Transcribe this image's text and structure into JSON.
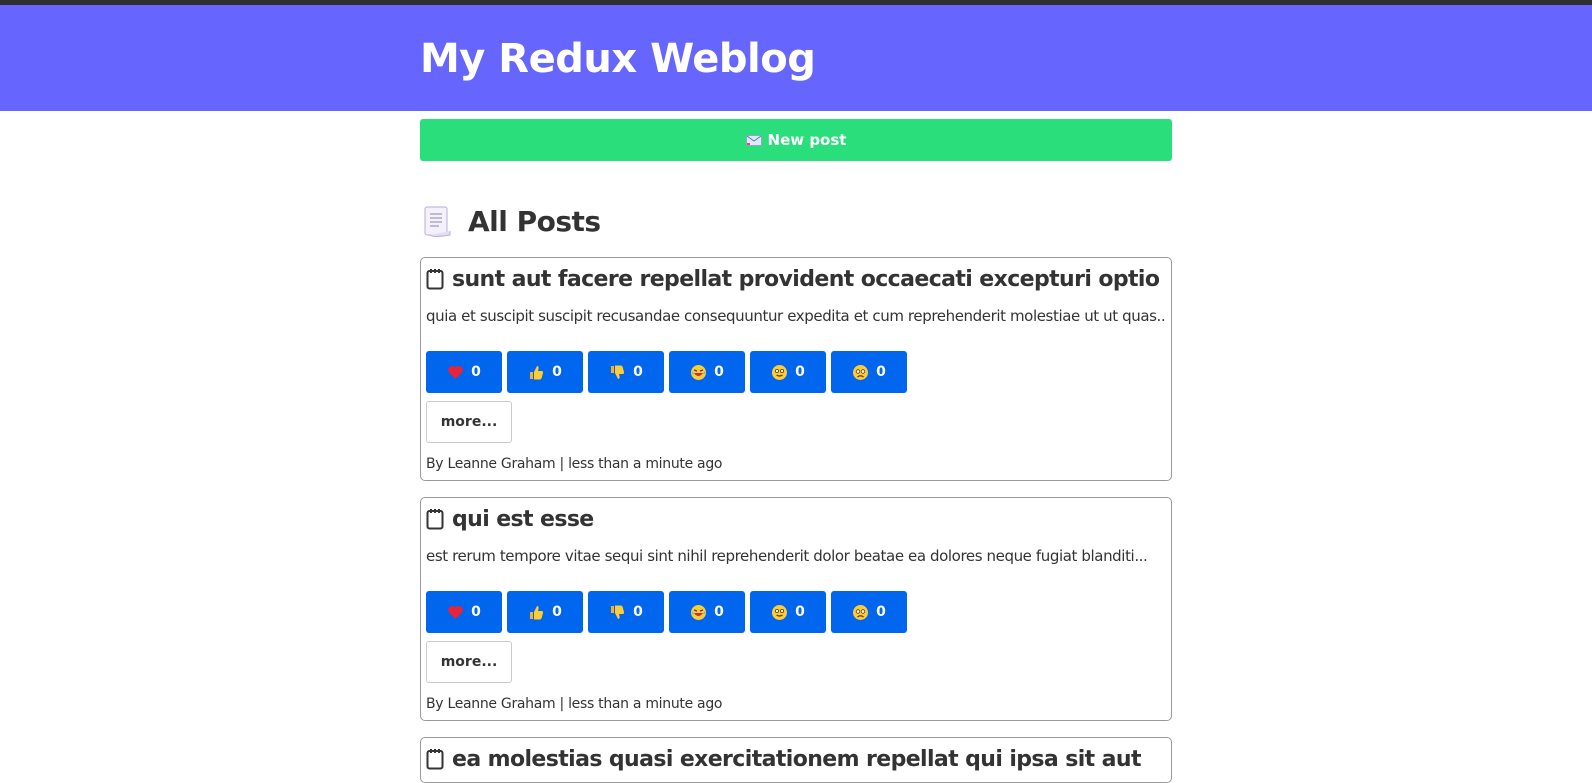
{
  "site": {
    "title": "My Redux Weblog"
  },
  "toolbar": {
    "new_post_label": "New post",
    "new_post_icon": "envelope-icon"
  },
  "section": {
    "title": "All Posts",
    "icon": "page-icon"
  },
  "colors": {
    "header_bg": "#6666ff",
    "new_post_bg": "#2ade7c",
    "reaction_bg": "#0066ee",
    "text": "#333333"
  },
  "posts": [
    {
      "title": "sunt aut facere repellat provident occaecati excepturi optio reprehenderit",
      "excerpt": "quia et suscipit suscipit recusandae consequuntur expedita et cum reprehenderit molestiae ut ut quas...",
      "reactions": [
        {
          "icon": "heart-icon",
          "count": "0"
        },
        {
          "icon": "thumbs-up-icon",
          "count": "0"
        },
        {
          "icon": "thumbs-down-icon",
          "count": "0"
        },
        {
          "icon": "laughing-face-icon",
          "count": "0"
        },
        {
          "icon": "smiling-face-icon",
          "count": "0"
        },
        {
          "icon": "sad-face-icon",
          "count": "0"
        }
      ],
      "more_label": "more...",
      "author": "By Leanne Graham",
      "separator": " | ",
      "time": "less than a minute ago"
    },
    {
      "title": "qui est esse",
      "excerpt": "est rerum tempore vitae sequi sint nihil reprehenderit dolor beatae ea dolores neque fugiat blanditi...",
      "reactions": [
        {
          "icon": "heart-icon",
          "count": "0"
        },
        {
          "icon": "thumbs-up-icon",
          "count": "0"
        },
        {
          "icon": "thumbs-down-icon",
          "count": "0"
        },
        {
          "icon": "laughing-face-icon",
          "count": "0"
        },
        {
          "icon": "smiling-face-icon",
          "count": "0"
        },
        {
          "icon": "sad-face-icon",
          "count": "0"
        }
      ],
      "more_label": "more...",
      "author": "By Leanne Graham",
      "separator": " | ",
      "time": "less than a minute ago"
    },
    {
      "title": "ea molestias quasi exercitationem repellat qui ipsa sit aut",
      "excerpt": "",
      "reactions": [],
      "more_label": "",
      "author": "",
      "separator": "",
      "time": ""
    }
  ]
}
